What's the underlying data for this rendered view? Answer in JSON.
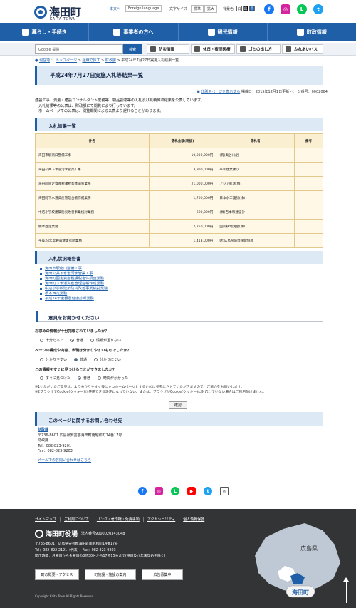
{
  "header": {
    "logo_title": "海田町",
    "logo_sub": "KAITA TOWN",
    "links": [
      "本文へ",
      "Foreign language",
      "文字サイズ",
      "標準",
      "拡大",
      "背景色",
      "白",
      "黒",
      "青"
    ],
    "social": [
      "facebook-icon",
      "instagram-icon",
      "line-icon",
      "twitter-icon"
    ]
  },
  "nav": {
    "items": [
      "暮らし・手続き",
      "事業者の方へ",
      "観光情報",
      "町政情報"
    ]
  },
  "search": {
    "placeholder": "Google 提供",
    "button": "検索"
  },
  "quick_links": [
    "防災情報",
    "休日・夜間医療",
    "ゴミの出し方",
    "ふれあいバス"
  ],
  "breadcrumb": {
    "current_label": "現在地",
    "items": [
      "トップページ",
      "組織で探す",
      "財政課"
    ],
    "current": "平成24年7月27日実施入札結果一覧"
  },
  "page": {
    "title": "平成24年7月27日実施入札等結果一覧",
    "print_link": "印刷用ページを表示する",
    "updated": "掲載日：2015年12月1日更新",
    "page_no": "ページ番号：0002064",
    "intro": [
      "建設工事、測量・建設コンサルタント業務等、物品調達等の入札及び見積徴収結果を公表しています。",
      "入札結果等の公表は、財政課にて閲覧により行っています。",
      "ホームページでの公表は、閲覧期間による公表より遅れることがあります。"
    ]
  },
  "results": {
    "heading": "入札結果一覧",
    "columns": [
      "件名",
      "落札金額(税抜)",
      "落札者",
      "備考"
    ],
    "rows": [
      {
        "name": "海田市駅南口整備工事",
        "amount": "10,000,000円",
        "winner": "(有)奥谷川組",
        "note": ""
      },
      {
        "name": "海田公共下水道汚水管渠工事",
        "amount": "3,900,000円",
        "winner": "平和建業(株)",
        "note": ""
      },
      {
        "name": "海田町固定資産税課税客体調査業務",
        "amount": "21,000,000円",
        "winner": "アジア航測(株)",
        "note": ""
      },
      {
        "name": "海田町下水道資産管理台帳作成業務",
        "amount": "1,700,000円",
        "winner": "日本水工設計(株)",
        "note": ""
      },
      {
        "name": "中店小学校建築防災改善事業検討業務",
        "amount": "690,000円",
        "winner": "(株)吉本和建設計",
        "note": ""
      },
      {
        "name": "橋本西定業務",
        "amount": "2,250,000円",
        "winner": "国川耕地測量(株)",
        "note": ""
      },
      {
        "name": "平成24年度観農健康診断業務",
        "amount": "1,413,000円",
        "winner": "財)広島県環境保健協会",
        "note": ""
      }
    ]
  },
  "reports": {
    "heading": "入札状況報告書",
    "items": [
      "海田市駅南口整備工事",
      "海田公共下水道汚水管渠工事",
      "海田町固定資産税課税客体調査業務",
      "海田町下水道資産管理台帳作成業務",
      "中店小学校建築防災改善事業検討業務",
      "橋本西定業務",
      "平成24年度観農健康診断業務"
    ]
  },
  "survey": {
    "heading": "意見をお聞かせください",
    "questions": [
      {
        "text": "お求めの情報が十分掲載されていましたか？",
        "options": [
          "十分だった",
          "普通",
          "情報が足りない"
        ]
      },
      {
        "text": "ページの構成や内容、表現は分かりやすいものでしたか？",
        "options": [
          "分かりやすい",
          "普通",
          "分かりにくい"
        ]
      },
      {
        "text": "この情報をすぐに見つけることができましたか？",
        "options": [
          "すぐに見つけた",
          "普通",
          "時間がかかった"
        ]
      }
    ],
    "notes": [
      "※1いただいたご意見は、より分かりやすく役に立つホームページとするために参考にさせていただきますので、ご協力をお願いします。",
      "※2ブラウザでCookie(クッキー)が使用できる設定になっていない、または、ブラウザがCookie(クッキー)に対応していない場合はご利用頂けません。"
    ],
    "submit": "確認"
  },
  "contact": {
    "heading": "このページに関するお問い合わせ先",
    "dept": "財政課",
    "address": "〒736-8601 広島県安芸郡海田町南昭和町14番17号",
    "dept2": "財政課",
    "tel": "Tel：082-823-9201",
    "fax": "Fax：082-823-9203",
    "mail": "メールでのお問い合わせはこちら"
  },
  "share_icons": [
    "facebook-icon",
    "instagram-icon",
    "line-icon",
    "youtube-icon",
    "twitter-icon",
    "mail-icon"
  ],
  "footer": {
    "links": [
      "サイトマップ",
      "ご利用について",
      "リンク・著作権・免責事項",
      "アクセシビリティ",
      "個人情報保護"
    ],
    "org": "海田町役場",
    "corp_no": "法人番号9000020343048",
    "address": "〒736-8601　広島県安芸郡海田町南昭和町14番17号",
    "tel": "Tel：082-822-2121（代表）　Fax：082-823-9203",
    "hours": "開庁時間：月曜日から金曜日の8時30分から17時15分まで(祝日及び年末年始を除く)",
    "buttons": [
      "町の概要・アクセス",
      "町施設・施設の案内",
      "広告募集中"
    ],
    "copyright": "Copyright Kaita Town All Rights Reserved.",
    "map_labels": [
      "広島県",
      "広島市",
      "海田町"
    ]
  }
}
